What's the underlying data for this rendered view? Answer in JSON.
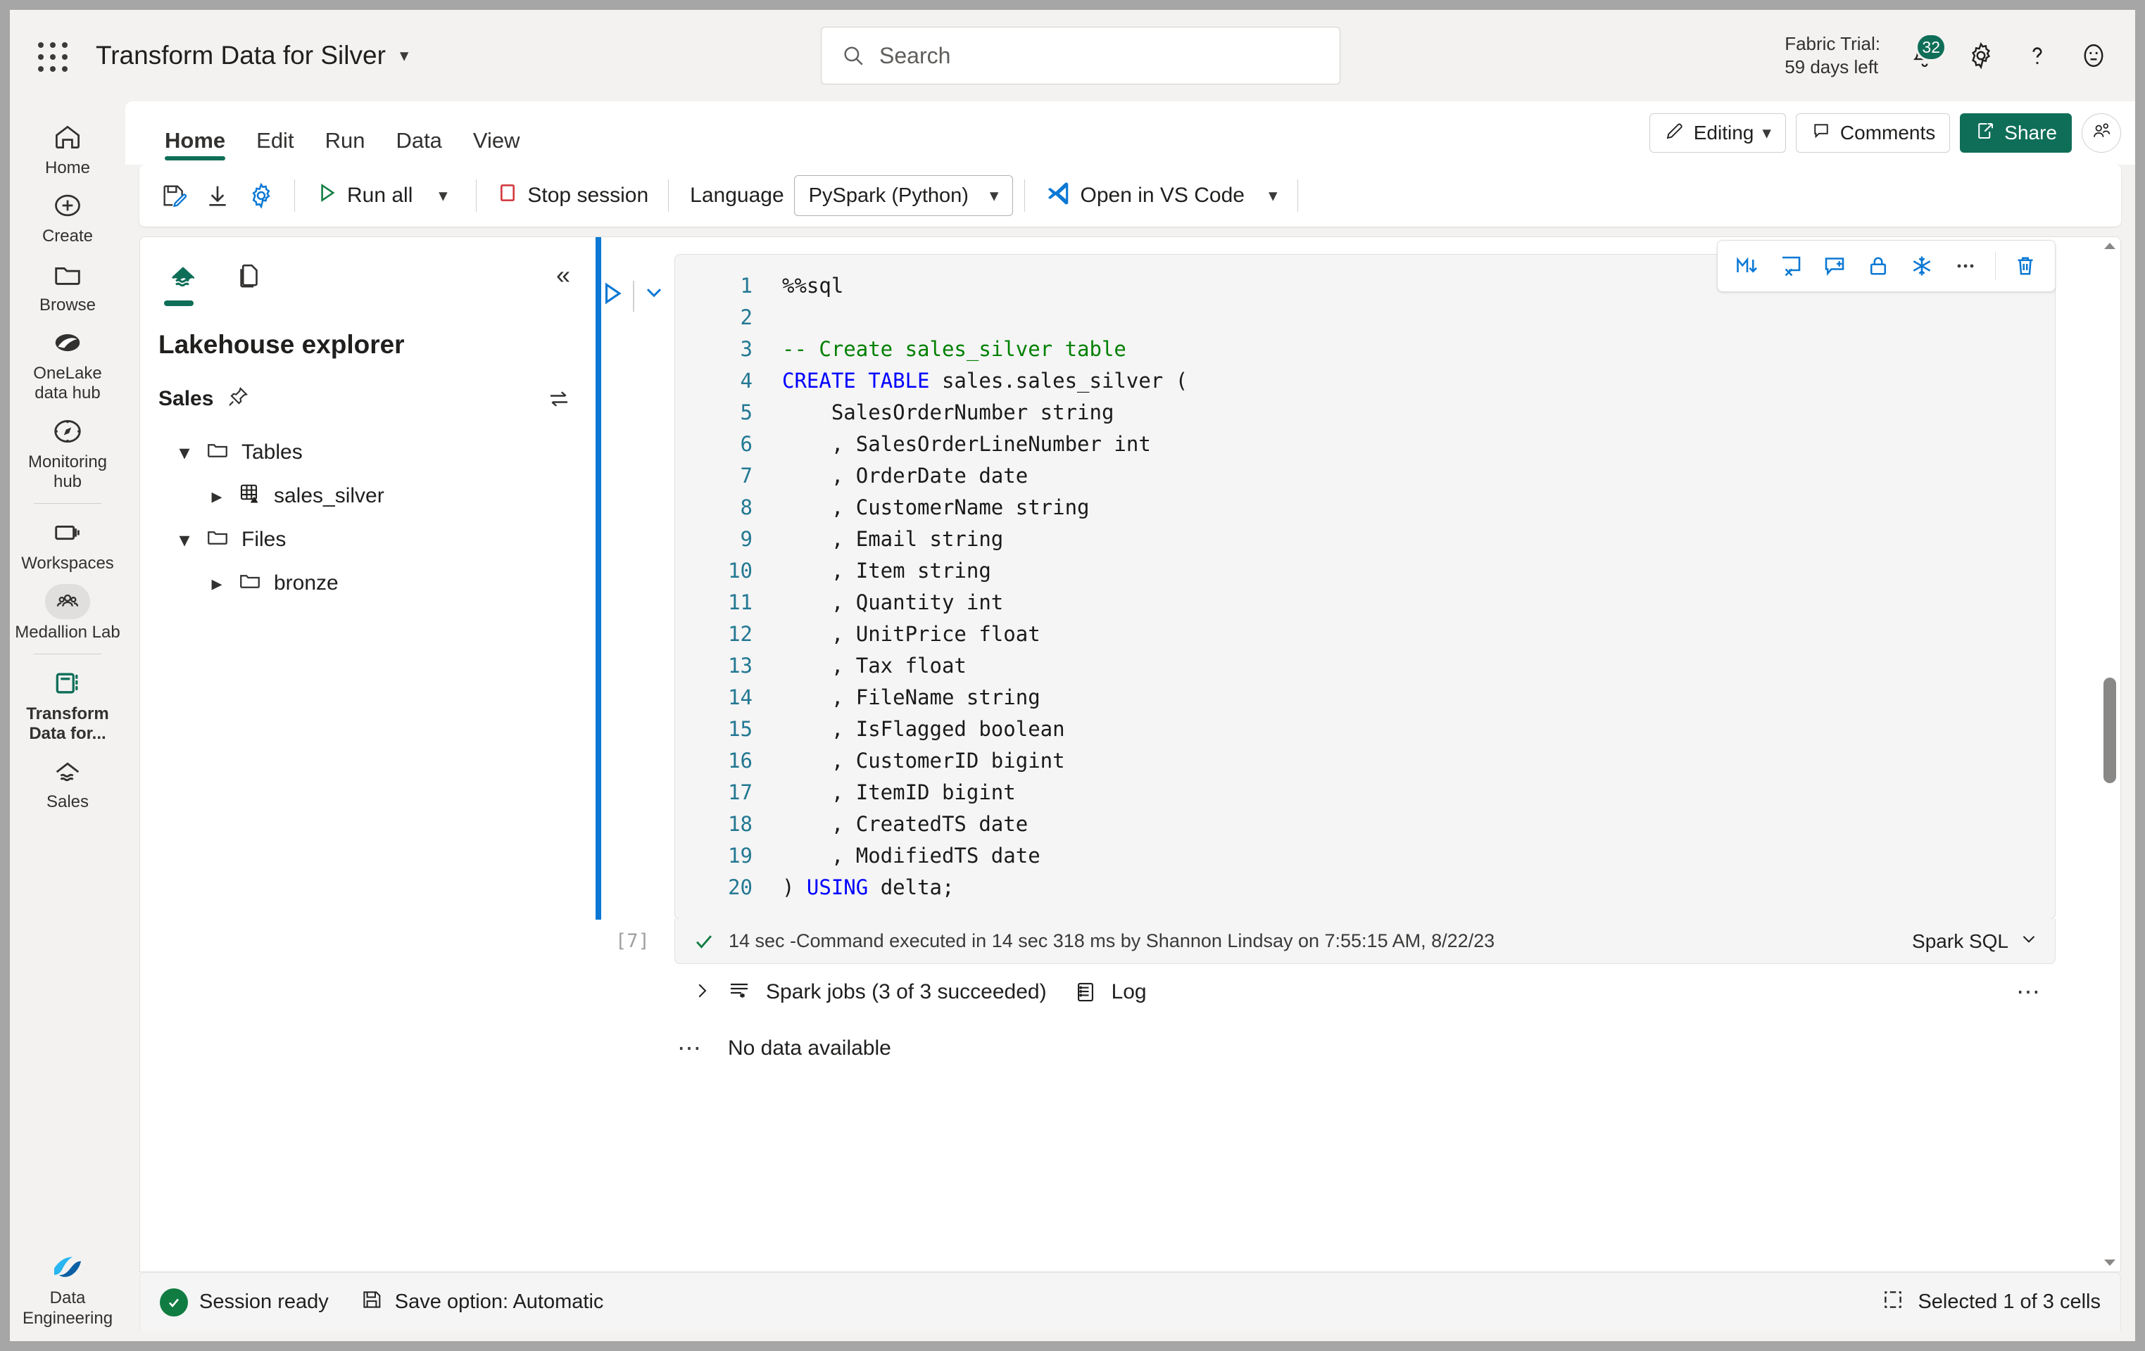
{
  "topbar": {
    "waffle_label": "app-launcher",
    "title": "Transform Data for Silver",
    "search_placeholder": "Search",
    "trial_line1": "Fabric Trial:",
    "trial_line2": "59 days left",
    "notification_count": "32",
    "accent_green": "#0f6e58"
  },
  "ribbon": {
    "tabs": [
      {
        "label": "Home",
        "active": true
      },
      {
        "label": "Edit",
        "active": false
      },
      {
        "label": "Run",
        "active": false
      },
      {
        "label": "Data",
        "active": false
      },
      {
        "label": "View",
        "active": false
      }
    ],
    "editing_label": "Editing",
    "comments_label": "Comments",
    "share_label": "Share"
  },
  "toolbar": {
    "run_all_label": "Run all",
    "stop_session_label": "Stop session",
    "language_label": "Language",
    "language_value": "PySpark (Python)",
    "vscode_label": "Open in VS Code"
  },
  "sidebar": {
    "items": [
      {
        "label": "Home",
        "icon": "home-icon",
        "active": false
      },
      {
        "label": "Create",
        "icon": "plus-circle-icon",
        "active": false
      },
      {
        "label": "Browse",
        "icon": "folder-icon",
        "active": false
      },
      {
        "label": "OneLake data hub",
        "icon": "onelake-icon",
        "active": false
      },
      {
        "label": "Monitoring hub",
        "icon": "compass-icon",
        "active": false
      },
      {
        "label": "Workspaces",
        "icon": "workspaces-icon",
        "active": false
      },
      {
        "label": "Medallion Lab",
        "icon": "people-icon",
        "active": false
      },
      {
        "label": "Transform Data for...",
        "icon": "notebook-icon",
        "active": true
      },
      {
        "label": "Sales",
        "icon": "lakehouse-icon",
        "active": false
      }
    ],
    "footer": {
      "label": "Data Engineering",
      "icon": "fabric-icon"
    }
  },
  "explorer": {
    "title": "Lakehouse explorer",
    "lakehouse_name": "Sales",
    "tabs": [
      {
        "name": "lakehouse-tab",
        "icon": "lakehouse-icon",
        "active": true
      },
      {
        "name": "files-tab",
        "icon": "documents-icon",
        "active": false
      }
    ],
    "tree": [
      {
        "label": "Tables",
        "icon": "folder-icon",
        "twisty": "expanded",
        "level": 1
      },
      {
        "label": "sales_silver",
        "icon": "delta-table-icon",
        "twisty": "collapsed",
        "level": 2
      },
      {
        "label": "Files",
        "icon": "folder-icon",
        "twisty": "expanded",
        "level": 1
      },
      {
        "label": "bronze",
        "icon": "folder-icon",
        "twisty": "collapsed",
        "level": 2
      }
    ]
  },
  "cell": {
    "execution_index": "[7]",
    "code_lines": [
      {
        "n": "1",
        "segments": [
          {
            "t": "%%sql",
            "c": "magic"
          }
        ]
      },
      {
        "n": "2",
        "segments": [
          {
            "t": "",
            "c": "plain"
          }
        ]
      },
      {
        "n": "3",
        "segments": [
          {
            "t": "-- Create sales_silver table",
            "c": "cmt"
          }
        ]
      },
      {
        "n": "4",
        "segments": [
          {
            "t": "CREATE TABLE",
            "c": "kw"
          },
          {
            "t": " sales.sales_silver (",
            "c": "plain"
          }
        ]
      },
      {
        "n": "5",
        "segments": [
          {
            "t": "    SalesOrderNumber string",
            "c": "plain"
          }
        ]
      },
      {
        "n": "6",
        "segments": [
          {
            "t": "    , SalesOrderLineNumber int",
            "c": "plain"
          }
        ]
      },
      {
        "n": "7",
        "segments": [
          {
            "t": "    , OrderDate date",
            "c": "plain"
          }
        ]
      },
      {
        "n": "8",
        "segments": [
          {
            "t": "    , CustomerName string",
            "c": "plain"
          }
        ]
      },
      {
        "n": "9",
        "segments": [
          {
            "t": "    , Email string",
            "c": "plain"
          }
        ]
      },
      {
        "n": "10",
        "segments": [
          {
            "t": "    , Item string",
            "c": "plain"
          }
        ]
      },
      {
        "n": "11",
        "segments": [
          {
            "t": "    , Quantity int",
            "c": "plain"
          }
        ]
      },
      {
        "n": "12",
        "segments": [
          {
            "t": "    , UnitPrice float",
            "c": "plain"
          }
        ]
      },
      {
        "n": "13",
        "segments": [
          {
            "t": "    , Tax float",
            "c": "plain"
          }
        ]
      },
      {
        "n": "14",
        "segments": [
          {
            "t": "    , FileName string",
            "c": "plain"
          }
        ]
      },
      {
        "n": "15",
        "segments": [
          {
            "t": "    , IsFlagged boolean",
            "c": "plain"
          }
        ]
      },
      {
        "n": "16",
        "segments": [
          {
            "t": "    , CustomerID bigint",
            "c": "plain"
          }
        ]
      },
      {
        "n": "17",
        "segments": [
          {
            "t": "    , ItemID bigint",
            "c": "plain"
          }
        ]
      },
      {
        "n": "18",
        "segments": [
          {
            "t": "    , CreatedTS date",
            "c": "plain"
          }
        ]
      },
      {
        "n": "19",
        "segments": [
          {
            "t": "    , ModifiedTS date",
            "c": "plain"
          }
        ]
      },
      {
        "n": "20",
        "segments": [
          {
            "t": ") ",
            "c": "plain"
          },
          {
            "t": "USING",
            "c": "kw"
          },
          {
            "t": " delta;",
            "c": "plain"
          }
        ]
      }
    ],
    "status_text": "14 sec -Command executed in 14 sec 318 ms by Shannon Lindsay on 7:55:15 AM, 8/22/23",
    "language_selector": "Spark SQL",
    "spark_jobs_label": "Spark jobs (3 of 3 succeeded)",
    "log_label": "Log",
    "no_data_label": "No data available",
    "toolbar_icons": [
      "markdown-convert-icon",
      "clear-output-icon",
      "add-comment-icon",
      "lock-icon",
      "freeze-icon",
      "more-options-icon",
      "delete-icon"
    ]
  },
  "statusbar": {
    "session_status": "Session ready",
    "save_option": "Save option: Automatic",
    "selection": "Selected 1 of 3 cells"
  }
}
